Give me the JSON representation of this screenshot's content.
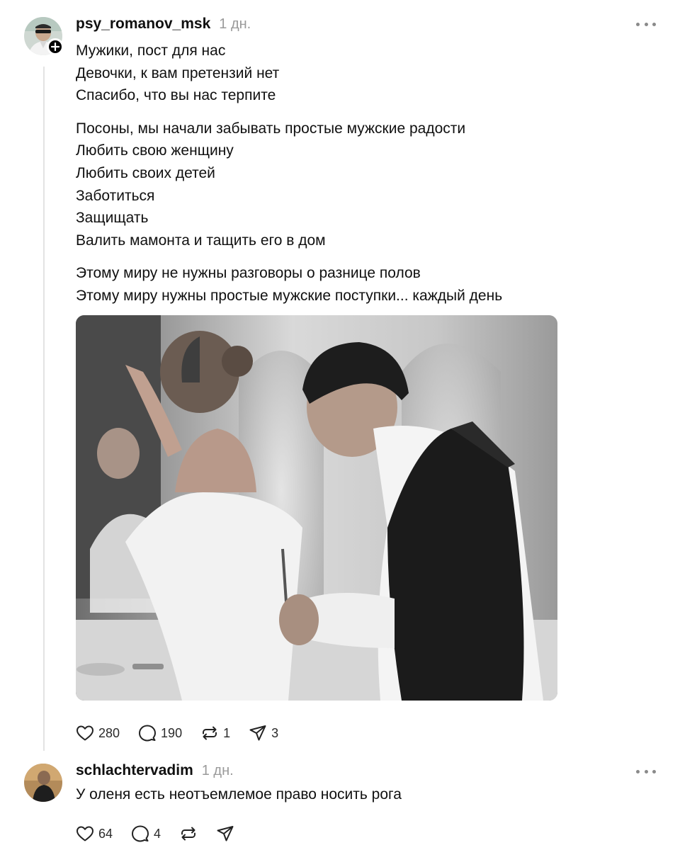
{
  "post": {
    "username": "psy_romanov_msk",
    "time": "1 дн.",
    "paragraphs": [
      [
        "Мужики, пост для нас",
        "Девочки, к вам претензий нет",
        "Спасибо, что вы нас терпите"
      ],
      [
        "Посоны, мы начали забывать простые мужские радости",
        "Любить свою женщину",
        "Любить своих детей",
        "Заботиться",
        "Защищать",
        "Валить мамонта и тащить его в дом"
      ],
      [
        "Этому миру не нужны разговоры о разнице полов",
        "Этому миру нужны простые мужские поступки... каждый день"
      ]
    ],
    "stats": {
      "likes": "280",
      "comments": "190",
      "reposts": "1",
      "shares": "3"
    }
  },
  "reply": {
    "username": "schlachtervadim",
    "time": "1 дн.",
    "text": "У оленя есть неотъемлемое право носить рога",
    "stats": {
      "likes": "64",
      "comments": "4"
    }
  },
  "icons": {
    "like": "heart-icon",
    "comment": "speech-bubble-icon",
    "repost": "repost-arrows-icon",
    "share": "paper-plane-icon",
    "more": "more-dots-icon",
    "follow": "plus-icon"
  },
  "colors": {
    "text": "#101010",
    "muted": "#9a9a9a",
    "thread_line": "#e3e3e3"
  }
}
